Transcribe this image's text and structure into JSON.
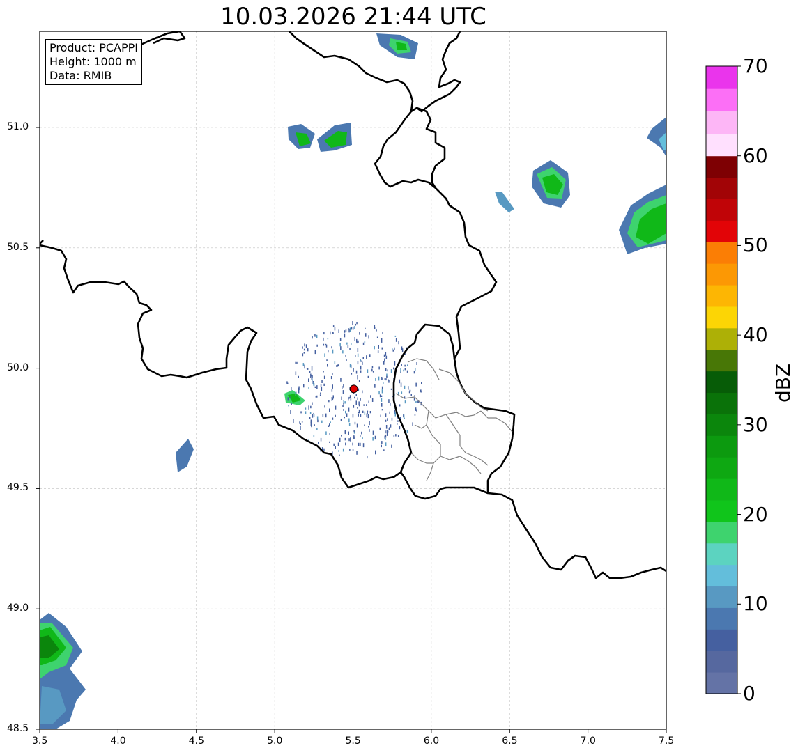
{
  "title": "10.03.2026 21:44 UTC",
  "info_box": {
    "product": "Product: PCAPPI",
    "height": "Height: 1000 m",
    "data": "Data: RMIB"
  },
  "colorbar": {
    "label": "dBZ",
    "ticks": [
      "0",
      "10",
      "20",
      "30",
      "40",
      "50",
      "60",
      "70"
    ],
    "colors": [
      "#6473a6",
      "#56689f",
      "#4560a0",
      "#4b78b0",
      "#5899c2",
      "#63bedb",
      "#5cd3c0",
      "#3ed36e",
      "#10c51b",
      "#10b818",
      "#0ea812",
      "#0c9a0f",
      "#0b860c",
      "#0a7209",
      "#075c07",
      "#487706",
      "#adb006",
      "#fcd505",
      "#fdb603",
      "#fc9804",
      "#fb7e05",
      "#e20407",
      "#c00407",
      "#a20406",
      "#7e0003",
      "#ffe0fe",
      "#fdb6f6",
      "#fc6ff6",
      "#ea34ec"
    ]
  },
  "axes": {
    "lon_ticks": [
      "3.5",
      "4.0",
      "4.5",
      "5.0",
      "5.5",
      "6.0",
      "6.5",
      "7.0",
      "7.5"
    ],
    "lat_ticks": [
      "48.5",
      "49.0",
      "49.5",
      "50.0",
      "50.5",
      "51.0"
    ]
  },
  "radar_site": {
    "lon": 5.505,
    "lat": 49.914,
    "color": "#e00000"
  },
  "map_colors": {
    "border": "#000000",
    "province": "#808080",
    "grid": "#c0c0c0"
  }
}
